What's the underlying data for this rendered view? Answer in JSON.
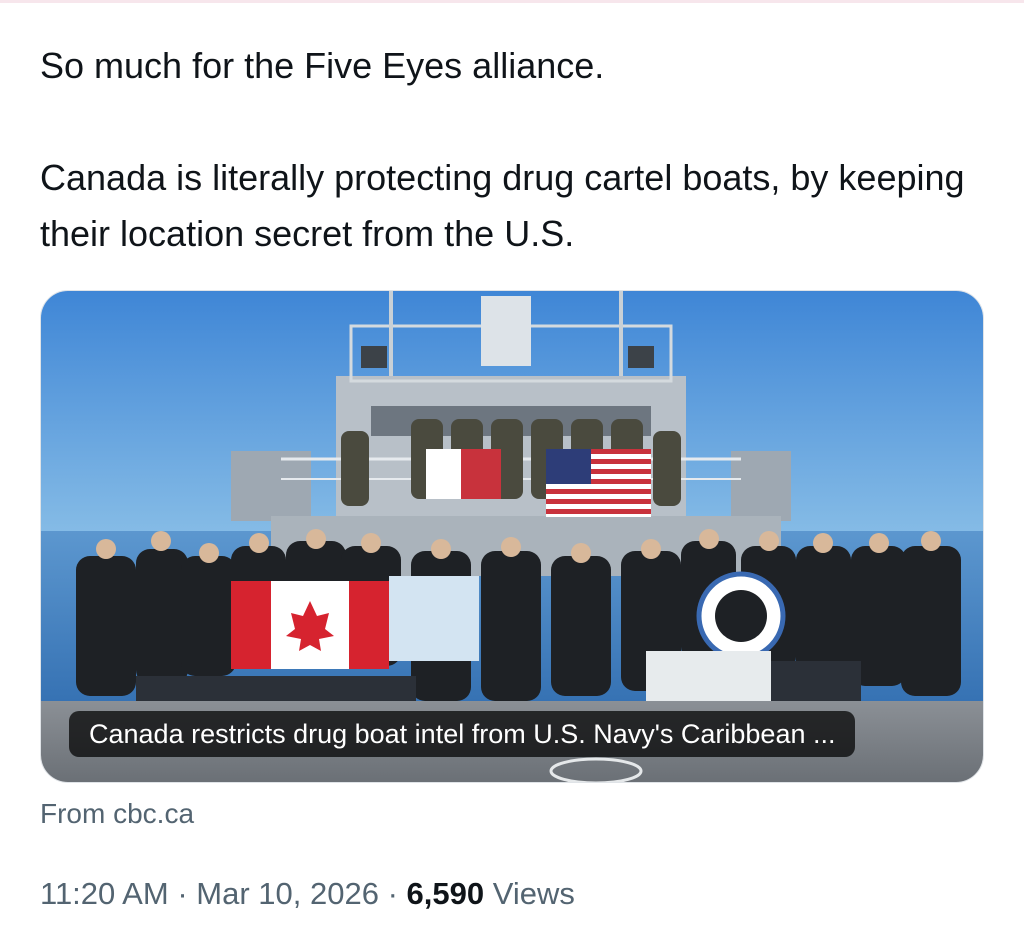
{
  "tweet": {
    "paragraphs": [
      "So much for the Five Eyes alliance.",
      "Canada is literally protecting drug cartel boats, by keeping their location secret from the U.S."
    ]
  },
  "link_card": {
    "title": "Canada restricts drug boat intel from U.S. Navy's Caribbean ...",
    "source": "From cbc.ca"
  },
  "meta": {
    "time": "11:20 AM",
    "separator": "·",
    "date": "Mar 10, 2026",
    "views_count": "6,590",
    "views_label": "Views"
  },
  "colors": {
    "text": "#0f1419",
    "secondary_text": "#536471",
    "sky": "#4f92d6",
    "sea": "#3f7fc4",
    "ship_gray": "#9aa5ae"
  }
}
